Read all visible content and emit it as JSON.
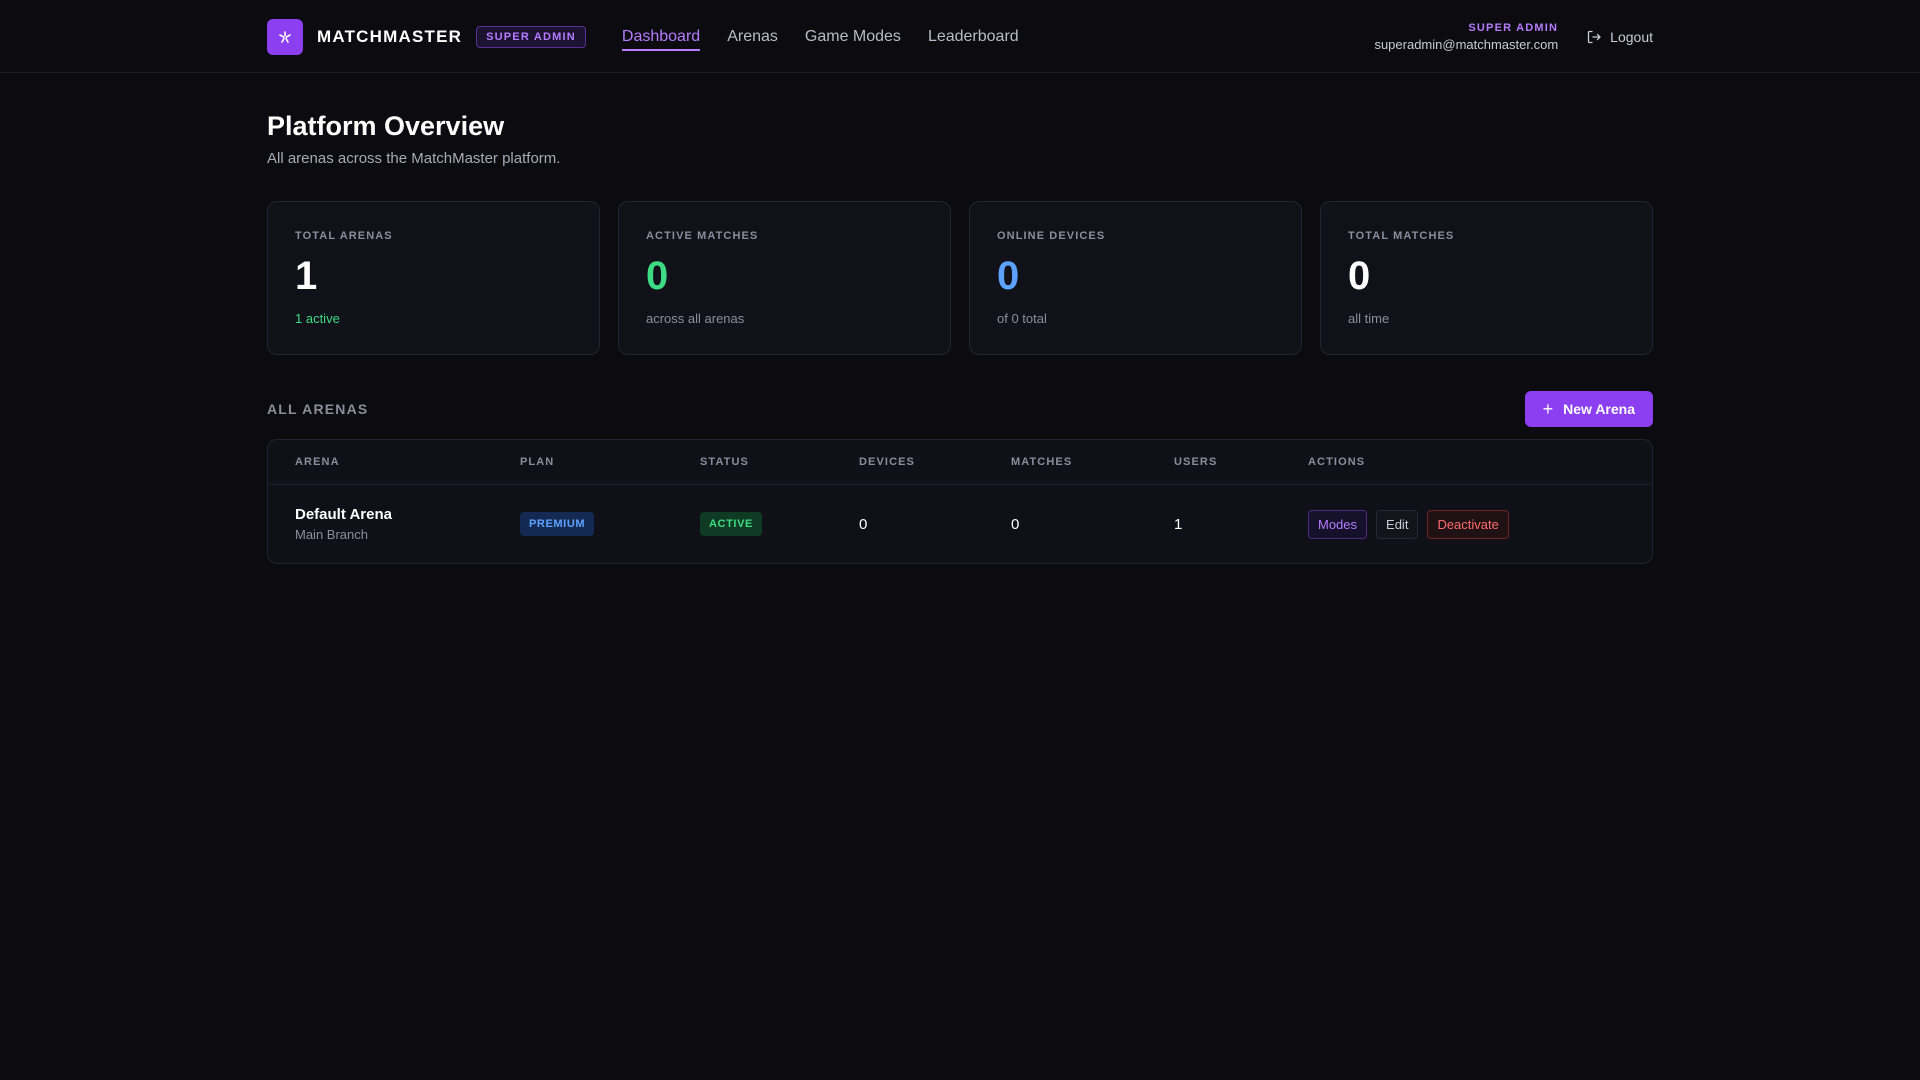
{
  "header": {
    "brand": "MATCHMASTER",
    "badge": "SUPER ADMIN",
    "nav": [
      {
        "label": "Dashboard",
        "active": true
      },
      {
        "label": "Arenas",
        "active": false
      },
      {
        "label": "Game Modes",
        "active": false
      },
      {
        "label": "Leaderboard",
        "active": false
      }
    ],
    "user_role": "SUPER ADMIN",
    "user_email": "superadmin@matchmaster.com",
    "logout_label": "Logout"
  },
  "page": {
    "title": "Platform Overview",
    "subtitle": "All arenas across the MatchMaster platform."
  },
  "stats": [
    {
      "label": "TOTAL ARENAS",
      "value": "1",
      "sub": "1 active",
      "value_color": "#ffffff",
      "sub_color": "#3ddc84"
    },
    {
      "label": "ACTIVE MATCHES",
      "value": "0",
      "sub": "across all arenas",
      "value_color": "#3ddc84",
      "sub_color": "#8a8e9b"
    },
    {
      "label": "ONLINE DEVICES",
      "value": "0",
      "sub": "of 0 total",
      "value_color": "#5ea2ff",
      "sub_color": "#8a8e9b"
    },
    {
      "label": "TOTAL MATCHES",
      "value": "0",
      "sub": "all time",
      "value_color": "#ffffff",
      "sub_color": "#8a8e9b"
    }
  ],
  "arenas_section": {
    "title": "ALL ARENAS",
    "new_button": "New Arena",
    "columns": [
      "ARENA",
      "PLAN",
      "STATUS",
      "DEVICES",
      "MATCHES",
      "USERS",
      "ACTIONS"
    ],
    "rows": [
      {
        "name": "Default Arena",
        "branch": "Main Branch",
        "plan": "PREMIUM",
        "status": "ACTIVE",
        "devices": "0",
        "matches": "0",
        "users": "1",
        "actions": {
          "modes": "Modes",
          "edit": "Edit",
          "deactivate": "Deactivate"
        }
      }
    ]
  },
  "colors": {
    "accent": "#8b3ff0",
    "accent_text": "#b57cff",
    "success": "#3ddc84",
    "info": "#5ea2ff",
    "danger": "#ff6b6b",
    "background": "#0b0b10"
  },
  "icons": {
    "logo": "spark-logo-icon",
    "logout": "logout-icon",
    "new_arena": "plus-icon"
  }
}
